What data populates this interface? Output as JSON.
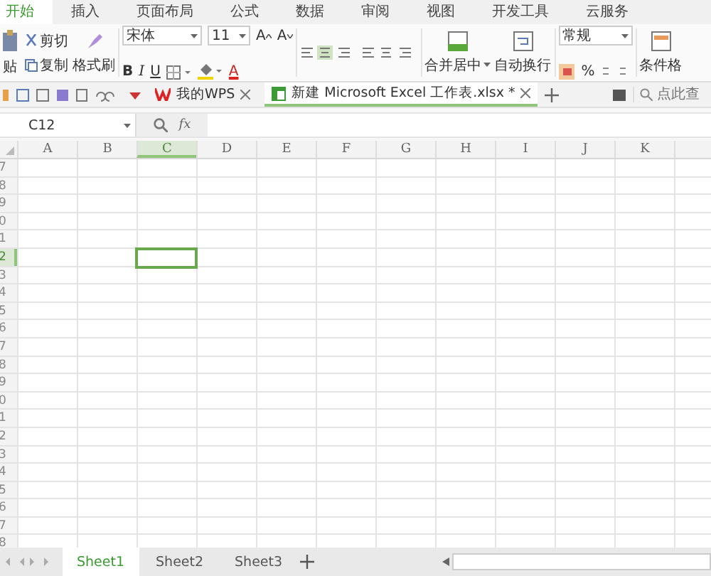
{
  "menu_tabs": [
    {
      "label": "开始",
      "selected": true
    },
    {
      "label": "插入",
      "selected": false
    },
    {
      "label": "页面布局",
      "selected": false
    },
    {
      "label": "公式",
      "selected": false
    },
    {
      "label": "数据",
      "selected": false
    },
    {
      "label": "审阅",
      "selected": false
    },
    {
      "label": "视图",
      "selected": false
    },
    {
      "label": "开发工具",
      "selected": false
    },
    {
      "label": "云服务",
      "selected": false
    }
  ],
  "clipboard": {
    "paste": "贴",
    "cut": "剪切",
    "copy": "复制",
    "format_painter": "格式刷"
  },
  "font": {
    "name": "宋体",
    "size": "11",
    "grow": "A",
    "shrink": "A",
    "bold": "B",
    "italic": "I",
    "underline": "U",
    "font_color_label": "A"
  },
  "alignment": {
    "merge": "合并居中",
    "wrap": "自动换行"
  },
  "number": {
    "format": "常规",
    "percent": "%"
  },
  "styles": {
    "conditional": "条件格"
  },
  "doc_tabs": [
    {
      "label": "我的WPS",
      "selected": false
    },
    {
      "label": "新建 Microsoft Excel 工作表.xlsx *",
      "selected": true
    }
  ],
  "search": {
    "placeholder": "点此查"
  },
  "formula_bar": {
    "name_box": "C12",
    "fx": "fx"
  },
  "columns": [
    {
      "label": "A",
      "selected": false
    },
    {
      "label": "B",
      "selected": false
    },
    {
      "label": "C",
      "selected": true
    },
    {
      "label": "D",
      "selected": false
    },
    {
      "label": "E",
      "selected": false
    },
    {
      "label": "F",
      "selected": false
    },
    {
      "label": "G",
      "selected": false
    },
    {
      "label": "H",
      "selected": false
    },
    {
      "label": "I",
      "selected": false
    },
    {
      "label": "J",
      "selected": false
    },
    {
      "label": "K",
      "selected": false
    }
  ],
  "rows": [
    {
      "label": "7",
      "selected": false
    },
    {
      "label": "8",
      "selected": false
    },
    {
      "label": "9",
      "selected": false
    },
    {
      "label": "0",
      "selected": false
    },
    {
      "label": "1",
      "selected": false
    },
    {
      "label": "2",
      "selected": true
    },
    {
      "label": "3",
      "selected": false
    },
    {
      "label": "4",
      "selected": false
    },
    {
      "label": "5",
      "selected": false
    },
    {
      "label": "6",
      "selected": false
    },
    {
      "label": "7",
      "selected": false
    },
    {
      "label": "8",
      "selected": false
    },
    {
      "label": "9",
      "selected": false
    },
    {
      "label": "0",
      "selected": false
    },
    {
      "label": "1",
      "selected": false
    },
    {
      "label": "2",
      "selected": false
    },
    {
      "label": "3",
      "selected": false
    },
    {
      "label": "4",
      "selected": false
    },
    {
      "label": "5",
      "selected": false
    },
    {
      "label": "6",
      "selected": false
    },
    {
      "label": "7",
      "selected": false
    },
    {
      "label": "8",
      "selected": false
    }
  ],
  "sheets": [
    {
      "label": "Sheet1",
      "selected": true
    },
    {
      "label": "Sheet2",
      "selected": false
    },
    {
      "label": "Sheet3",
      "selected": false
    }
  ]
}
